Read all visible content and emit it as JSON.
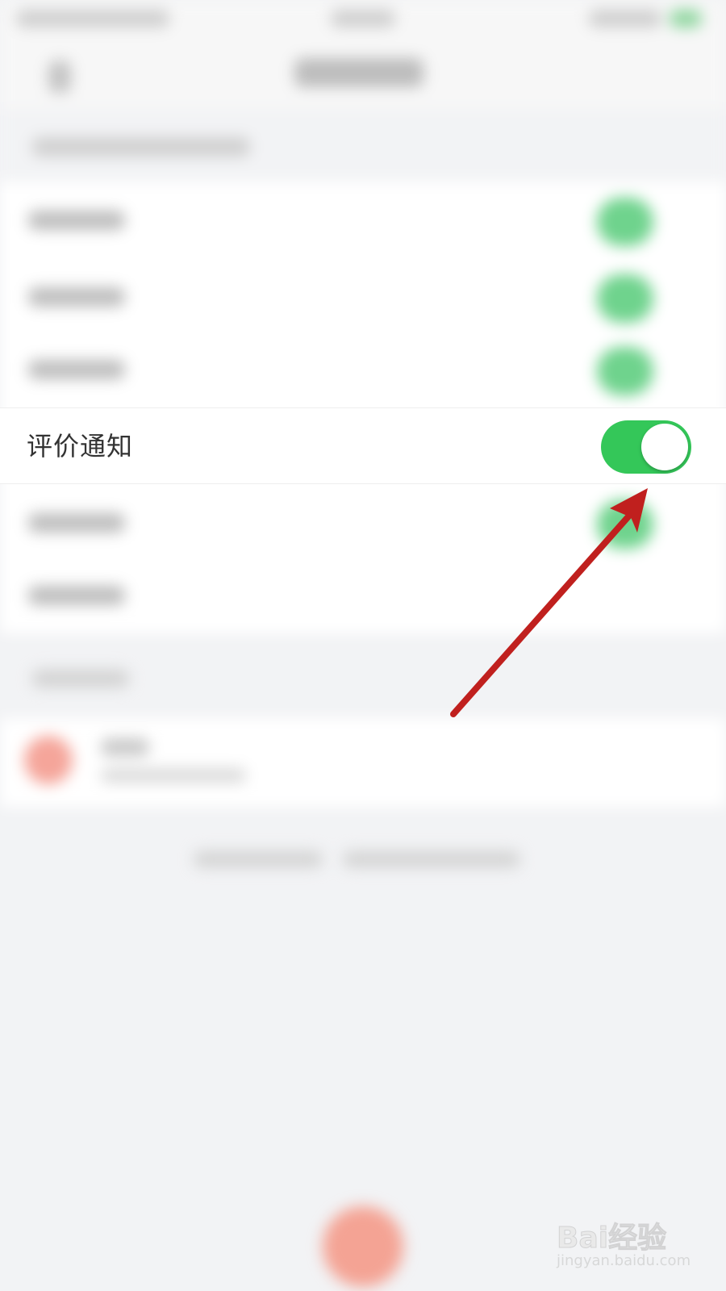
{
  "setting_row": {
    "label": "评价通知",
    "toggle_on": true
  },
  "colors": {
    "toggle_on": "#34c759",
    "arrow": "#c0201e",
    "background": "#f2f3f5"
  },
  "watermark": {
    "logo": "Bai经验",
    "url": "jingyan.baidu.com"
  }
}
